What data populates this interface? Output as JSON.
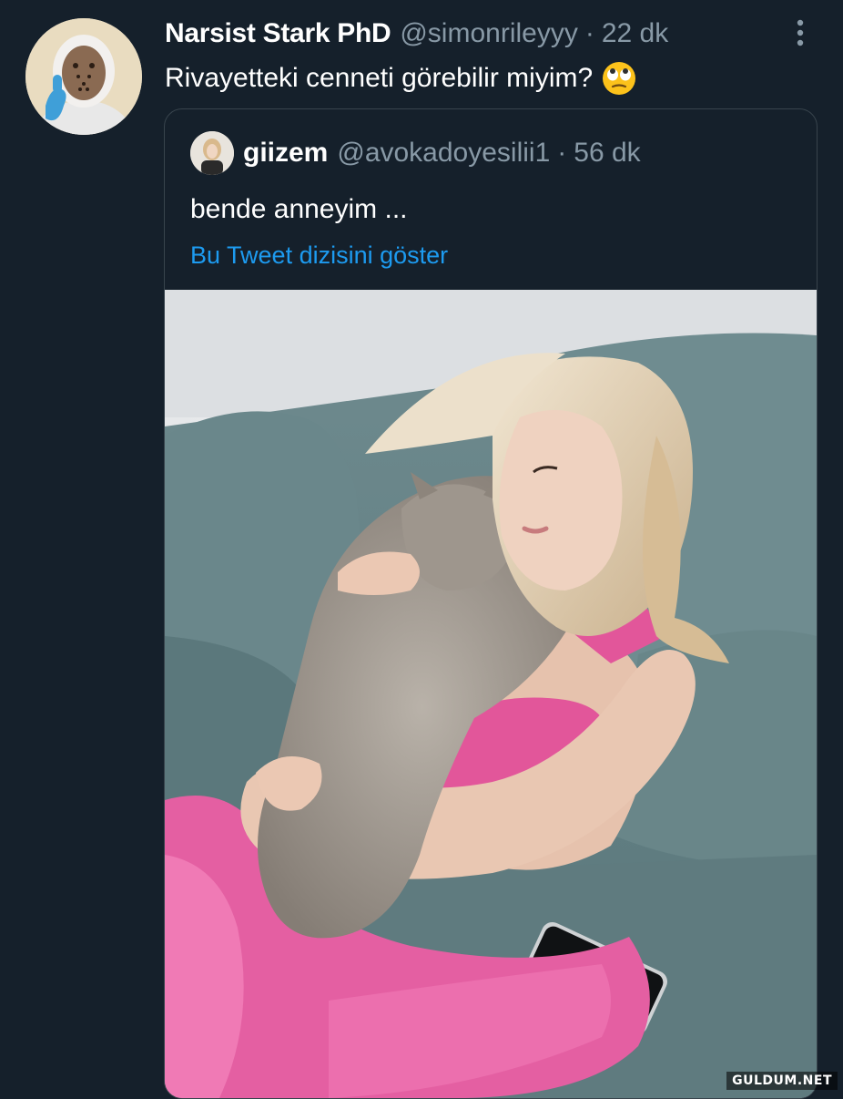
{
  "tweet": {
    "display_name": "Narsist Stark PhD",
    "handle": "@simonrileyyy",
    "separator": "·",
    "time": "22 dk",
    "text": "Rivayetteki cenneti görebilir miyim?",
    "emoji": "face-with-rolling-eyes-emoji",
    "more_icon": "more-vertical-icon"
  },
  "quoted_tweet": {
    "display_name": "giizem",
    "handle": "@avokadoyesilii1",
    "separator": "·",
    "time": "56 dk",
    "text": "bende anneyim ...",
    "show_thread_link": "Bu Tweet dizisini göster"
  },
  "watermark": "GULDUM.NET",
  "colors": {
    "background": "#15202b",
    "secondary_text": "#8899a6",
    "link": "#1d9bf0",
    "border": "#38444d"
  }
}
